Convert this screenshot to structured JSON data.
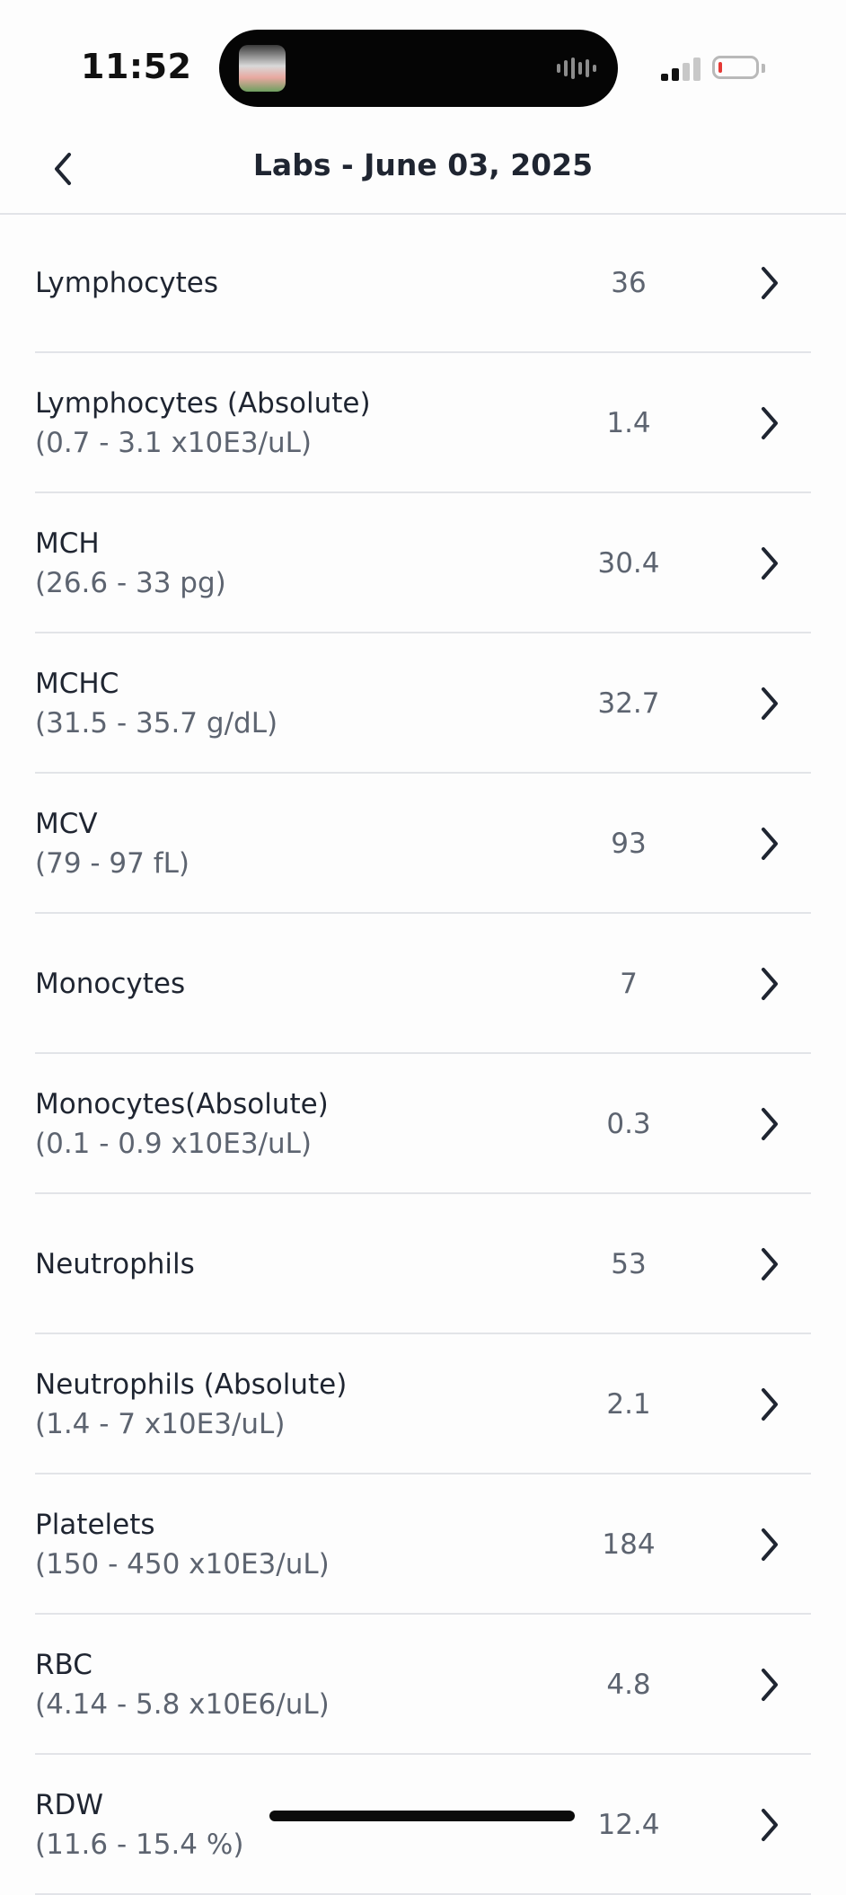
{
  "status_bar": {
    "time": "11:52"
  },
  "nav": {
    "title": "Labs - June 03, 2025",
    "back_icon": "chevron-left-icon"
  },
  "labs": [
    {
      "name": "Lymphocytes",
      "range": "",
      "value": "36"
    },
    {
      "name": "Lymphocytes (Absolute)",
      "range": "(0.7 - 3.1 x10E3/uL)",
      "value": "1.4"
    },
    {
      "name": "MCH",
      "range": "(26.6 - 33 pg)",
      "value": "30.4"
    },
    {
      "name": "MCHC",
      "range": "(31.5 - 35.7 g/dL)",
      "value": "32.7"
    },
    {
      "name": "MCV",
      "range": "(79 - 97 fL)",
      "value": "93"
    },
    {
      "name": "Monocytes",
      "range": "",
      "value": "7"
    },
    {
      "name": "Monocytes(Absolute)",
      "range": "(0.1 - 0.9 x10E3/uL)",
      "value": "0.3"
    },
    {
      "name": "Neutrophils",
      "range": "",
      "value": "53"
    },
    {
      "name": "Neutrophils (Absolute)",
      "range": "(1.4 - 7 x10E3/uL)",
      "value": "2.1"
    },
    {
      "name": "Platelets",
      "range": "(150 - 450 x10E3/uL)",
      "value": "184"
    },
    {
      "name": "RBC",
      "range": "(4.14 - 5.8 x10E6/uL)",
      "value": "4.8"
    },
    {
      "name": "RDW",
      "range": "(11.6 - 15.4 %)",
      "value": "12.4"
    }
  ],
  "colors": {
    "text_primary": "#1f2531",
    "text_secondary": "#5d6470",
    "divider": "#e2e4e8",
    "battery_low": "#e53935"
  }
}
